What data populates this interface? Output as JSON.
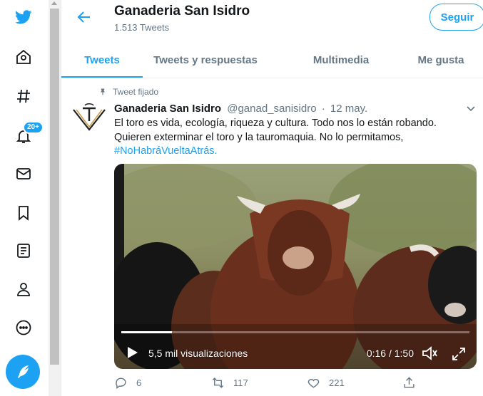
{
  "sidebar": {
    "icons": [
      "twitter-logo-icon",
      "home-icon",
      "hashtag-icon",
      "bell-icon",
      "mail-icon",
      "bookmark-icon",
      "list-icon",
      "profile-icon",
      "more-icon"
    ],
    "notifications_badge": "20+",
    "compose_icon": "feather-icon"
  },
  "header": {
    "title": "Ganaderia San Isidro",
    "tweet_count": "1.513 Tweets",
    "follow_label": "Seguir"
  },
  "tabs": [
    {
      "label": "Tweets",
      "active": true
    },
    {
      "label": "Tweets y respuestas",
      "active": false
    },
    {
      "label": "Multimedia",
      "active": false
    },
    {
      "label": "Me gusta",
      "active": false
    }
  ],
  "tweet": {
    "pinned_label": "Tweet fijado",
    "author_name": "Ganaderia San Isidro",
    "handle": "@ganad_sanisidro",
    "separator": "·",
    "date": "12 may.",
    "text_line1": "El toro es vida, ecología, riqueza y cultura. Todo  nos lo están robando.",
    "text_line2": "Quieren exterminar el toro y la tauromaquia. No lo permitamos,",
    "hashtag": "#NoHabráVueltaAtrás.",
    "video": {
      "views": "5,5 mil visualizaciones",
      "time": "0:16 / 1:50",
      "progress": 0.145
    },
    "actions": {
      "replies": "6",
      "retweets": "117",
      "likes": "221"
    }
  },
  "colors": {
    "accent": "#1da1f2",
    "secondary_text": "#657786",
    "border": "#e6ecf0"
  }
}
